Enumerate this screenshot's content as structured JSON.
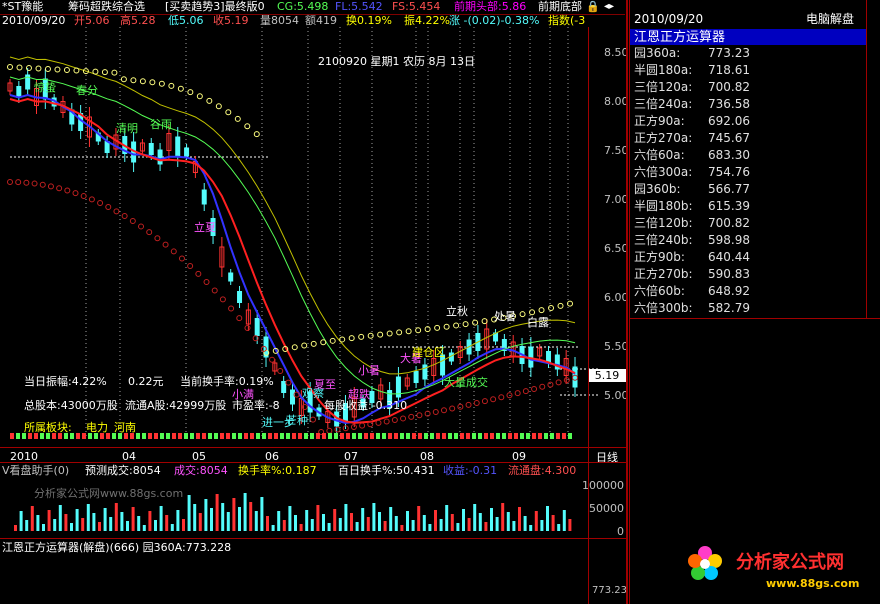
{
  "header": {
    "stock_name": "*ST豫能",
    "formula_name": "筹码超跌综合选",
    "formula_sub": "[买卖趋势3]最终版0",
    "cg_label": "CG:5.498",
    "fl_label": "FL:5.542",
    "fs_label": "FS:5.454",
    "prev_top_label": "前期头部:5.86",
    "prev_bottom_label": "前期底部",
    "date_label": "2010/09/20",
    "panel_title": "电脑解盘"
  },
  "quote": {
    "date": "2010/09/20",
    "open": "开5.06",
    "high": "高5.28",
    "low": "低5.06",
    "close": "收5.19",
    "volume": "量8054",
    "amount": "额419",
    "turnover": "换0.19%",
    "amplitude": "振4.22%",
    "change": "涨 -(0.02)-0.38%",
    "index_label": "指数(-3"
  },
  "overlay_date": "2100920 星期1 农历 8月 13日",
  "info": {
    "amplitude": "当日振幅:4.22%",
    "change_amt": "0.22元",
    "cur_turnover": "当前换手率:0.19%",
    "total_shares": "总股本:43000万股",
    "float_shares": "流通A股:42999万股",
    "pe": "市盈率:-8",
    "eps": "每股收益:-0.310",
    "sector_label": "所属板块:",
    "sector1": "电力",
    "sector2": "河南"
  },
  "chart_tags": [
    "惊蛰",
    "春分",
    "清明",
    "谷雨",
    "立夏",
    "小满",
    "夏至",
    "小暑",
    "芒种",
    "大暑",
    "立秋",
    "处暑",
    "白露",
    "建仓区",
    "大量成交",
    "观察",
    "进一步",
    "超跌"
  ],
  "price_axis": [
    "8.50",
    "8.00",
    "7.50",
    "7.00",
    "6.50",
    "6.00",
    "5.50",
    "5.00"
  ],
  "current_price": "5.19",
  "month_axis": [
    "2010",
    "04",
    "05",
    "06",
    "07",
    "08",
    "09"
  ],
  "period_label": "日线",
  "volume_header": {
    "title": "V看盘助手(0)",
    "forecast": "预测成交:8054",
    "turnover_label": "成交:8054",
    "turnover_rate": "换手率%:0.187",
    "hundred_day": "百日换手%:50.431",
    "float_label": "收益:-0.31",
    "flow_label": "流通盘:4.300"
  },
  "volume_axis": [
    "100000",
    "50000",
    "0"
  ],
  "watermark": "分析家公式网www.88gs.com",
  "bottom_label": "江恩正方运算器(解盘)(666) 园360A:773.228",
  "bottom_value": "773.23",
  "calc": {
    "title": "江恩正方运算器",
    "rows": [
      {
        "k": "园360a:",
        "v": "773.23"
      },
      {
        "k": "半圆180a:",
        "v": "718.61"
      },
      {
        "k": "三倍120a:",
        "v": "700.82"
      },
      {
        "k": "三倍240a:",
        "v": "736.58"
      },
      {
        "k": "正方90a:",
        "v": "692.06"
      },
      {
        "k": "正方270a:",
        "v": "745.67"
      },
      {
        "k": "六倍60a:",
        "v": "683.30"
      },
      {
        "k": "六倍300a:",
        "v": "754.76"
      },
      {
        "k": "园360b:",
        "v": "566.77"
      },
      {
        "k": "半圆180b:",
        "v": "615.39"
      },
      {
        "k": "三倍120b:",
        "v": "700.82"
      },
      {
        "k": "三倍240b:",
        "v": "598.98"
      },
      {
        "k": "正方90b:",
        "v": "640.44"
      },
      {
        "k": "正方270b:",
        "v": "590.83"
      },
      {
        "k": "六倍60b:",
        "v": "648.92"
      },
      {
        "k": "六倍300b:",
        "v": "582.79"
      }
    ]
  },
  "logo": {
    "title": "分析家公式网",
    "url": "www.88gs.com"
  },
  "colors": {
    "bg": "#000000",
    "frame": "#a00000",
    "up": "#ff3232",
    "down": "#54fcfc",
    "yellow": "#ffff00",
    "accent": "#ff00ff"
  }
}
